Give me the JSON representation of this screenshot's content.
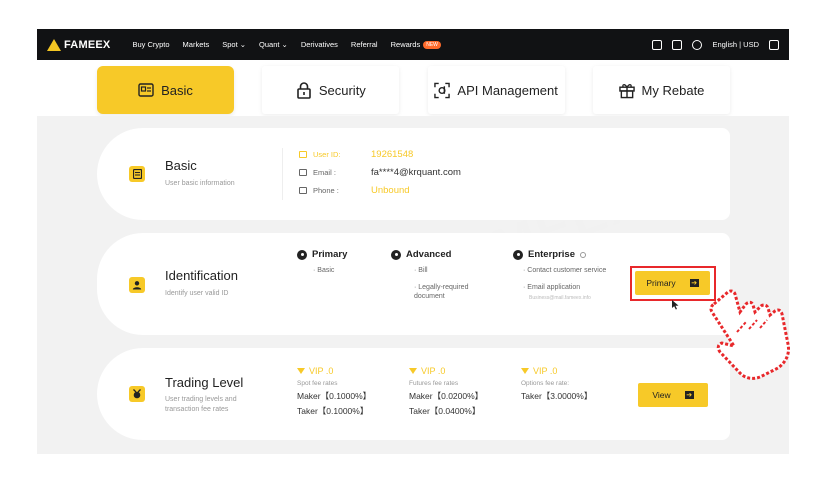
{
  "nav": {
    "logo": "FAMEEX",
    "items": [
      {
        "label": "Buy Crypto"
      },
      {
        "label": "Markets"
      },
      {
        "label": "Spot ⌄"
      },
      {
        "label": "Quant ⌄"
      },
      {
        "label": "Derivatives"
      },
      {
        "label": "Referral"
      },
      {
        "label": "Rewards"
      }
    ],
    "rewards_badge": "NEW",
    "language_currency": "English | USD"
  },
  "tabs": [
    {
      "label": "Basic",
      "active": true,
      "icon": "id-card-icon"
    },
    {
      "label": "Security",
      "active": false,
      "icon": "lock-icon"
    },
    {
      "label": "API Management",
      "active": false,
      "icon": "api-icon"
    },
    {
      "label": "My Rebate",
      "active": false,
      "icon": "gift-icon"
    }
  ],
  "watermark": "FAMEEX",
  "basic": {
    "title": "Basic",
    "subtitle": "User basic information",
    "user_id_label": "User ID:",
    "user_id": "19261548",
    "email_label": "Email :",
    "email": "fa****4@krquant.com",
    "phone_label": "Phone :",
    "phone": "Unbound"
  },
  "identification": {
    "title": "Identification",
    "subtitle": "Identify user valid ID",
    "levels": [
      {
        "name": "Primary",
        "items": [
          "· Basic"
        ]
      },
      {
        "name": "Advanced",
        "items": [
          "· Bill",
          "· Legally-required document"
        ]
      },
      {
        "name": "Enterprise",
        "items": [
          "· Contact customer service",
          "· Email application"
        ],
        "note": "Business@mail.fameex.info"
      }
    ],
    "button_label": "Primary"
  },
  "trading": {
    "title": "Trading Level",
    "subtitle": "User trading levels and transaction fee rates",
    "columns": [
      {
        "vip": "VIP .0",
        "label": "Spot fee rates",
        "lines": [
          "Maker【0.1000%】",
          "Taker【0.1000%】"
        ]
      },
      {
        "vip": "VIP .0",
        "label": "Futures fee rates",
        "lines": [
          "Maker【0.0200%】",
          "Taker【0.0400%】"
        ]
      },
      {
        "vip": "VIP .0",
        "label": "Options fee rate:",
        "lines": [
          "Taker【3.0000%】"
        ]
      }
    ],
    "button_label": "View"
  },
  "colors": {
    "accent": "#f7c928",
    "highlight": "#e8282b",
    "nav_bg": "#111214"
  }
}
